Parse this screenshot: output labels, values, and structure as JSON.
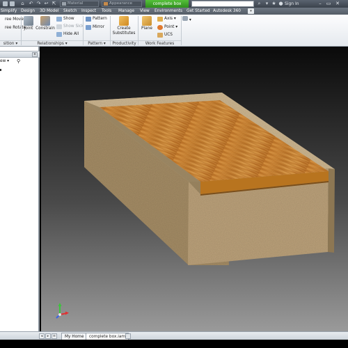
{
  "titlebar": {
    "material_combo": "Material",
    "appearance_combo": "Appearance",
    "document_tab": "complete box",
    "signin_label": "Sign In",
    "window_controls": [
      "–",
      "▭",
      "✕"
    ]
  },
  "menu": {
    "tabs": [
      "Simplify",
      "Design",
      "3D Model",
      "Sketch",
      "Inspect",
      "Tools",
      "Manage",
      "View",
      "Environments",
      "Get Started",
      "Autodesk 360"
    ]
  },
  "ribbon": {
    "free_move": "ree Move",
    "free_rotate": "ree Rotate",
    "joint": "Joint",
    "constrain": "Constrain",
    "show": "Show",
    "show_sick": "Show Sick",
    "hide_all": "Hide All",
    "pattern": "Pattern",
    "mirror": "Mirror",
    "create_substitutes_1": "Create",
    "create_substitutes_2": "Substitutes",
    "plane": "Plane",
    "axis": "Axis",
    "point": "Point",
    "ucs": "UCS",
    "panels": {
      "position": "sition ▾",
      "relationships": "Relationships ▾",
      "pattern": "Pattern ▾",
      "productivity": "Productivity",
      "work_features": "Work Features"
    }
  },
  "browser": {
    "view_dropdown": "ew ▾",
    "close": "x"
  },
  "doc_tabs": {
    "home": "My Home",
    "assembly": "complete box.iam"
  },
  "colors": {
    "accent_green": "#3aa827",
    "wood_top": "#c07a2c",
    "box_side": "#b79e76"
  }
}
